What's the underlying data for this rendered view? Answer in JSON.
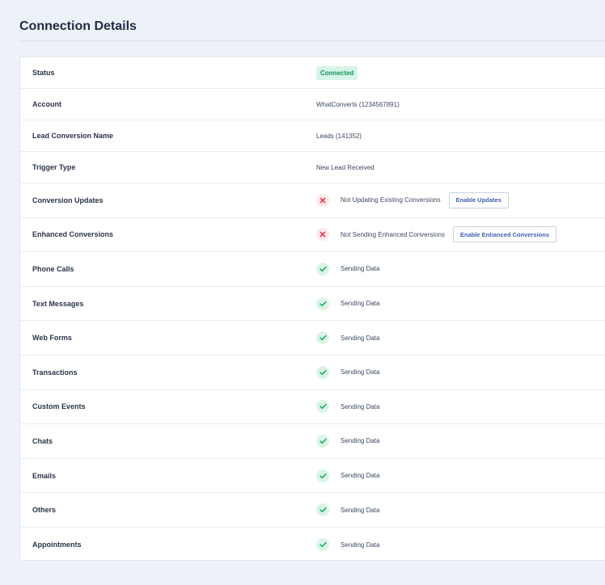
{
  "header": {
    "title": "Connection Details"
  },
  "rows": [
    {
      "label": "Status",
      "badge": "Connected"
    },
    {
      "label": "Account",
      "value": "WhatConverts (1234567891)"
    },
    {
      "label": "Lead Conversion Name",
      "value": "Leads (141352)"
    },
    {
      "label": "Trigger Type",
      "value": "New Lead Received"
    },
    {
      "label": "Conversion Updates",
      "icon": "x-icon",
      "status": "Not Updating Existing Conversions",
      "button": "Enable Updates"
    },
    {
      "label": "Enhanced Conversions",
      "icon": "x-icon",
      "status": "Not Sending Enhanced Conversions",
      "button": "Enable Enhanced Conversions"
    },
    {
      "label": "Phone Calls",
      "icon": "check-icon",
      "status": "Sending Data"
    },
    {
      "label": "Text Messages",
      "icon": "check-icon",
      "status": "Sending Data"
    },
    {
      "label": "Web Forms",
      "icon": "check-icon",
      "status": "Sending Data"
    },
    {
      "label": "Transactions",
      "icon": "check-icon",
      "status": "Sending Data"
    },
    {
      "label": "Custom Events",
      "icon": "check-icon",
      "status": "Sending Data"
    },
    {
      "label": "Chats",
      "icon": "check-icon",
      "status": "Sending Data"
    },
    {
      "label": "Emails",
      "icon": "check-icon",
      "status": "Sending Data"
    },
    {
      "label": "Others",
      "icon": "check-icon",
      "status": "Sending Data"
    },
    {
      "label": "Appointments",
      "icon": "check-icon",
      "status": "Sending Data"
    }
  ],
  "colors": {
    "page_background": "#edf2f9",
    "connected_badge_bg": "#d6f5e6",
    "connected_badge_text": "#17935a",
    "check_icon": "#25b36b",
    "x_icon": "#e2405a",
    "button_text": "#3a5fae"
  }
}
